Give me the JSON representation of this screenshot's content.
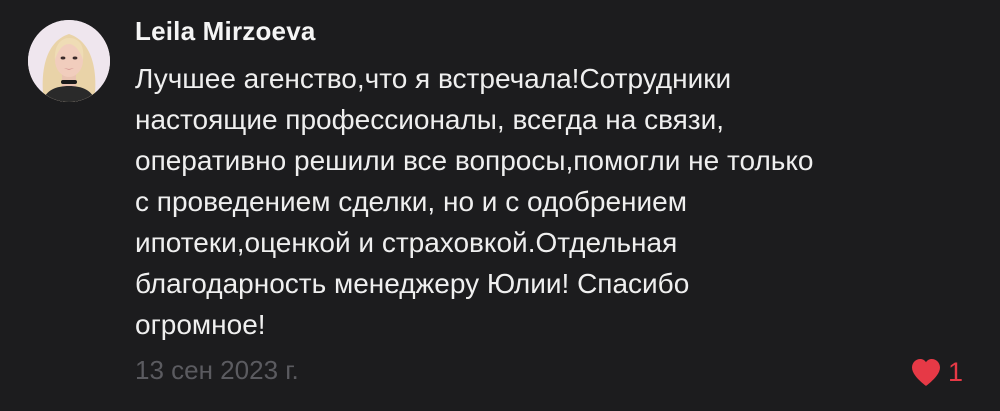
{
  "comment": {
    "author": "Leila Mirzoeva",
    "text_lines": [
      "Лучшее агенство,что я встречала!Сотрудники",
      "настоящие профессионалы, всегда на связи,",
      "оперативно решили все вопросы,помогли не только",
      "с проведением сделки, но и с одобрением",
      "ипотеки,оценкой и страховкой.Отдельная",
      "благодарность менеджеру Юлии! Спасибо",
      "огромное!"
    ],
    "date": "13 сен 2023 г.",
    "likes": "1",
    "like_icon": "heart-icon",
    "colors": {
      "background": "#1c1c1e",
      "text": "#efefef",
      "muted": "#5b5b60",
      "like": "#e63946"
    }
  }
}
